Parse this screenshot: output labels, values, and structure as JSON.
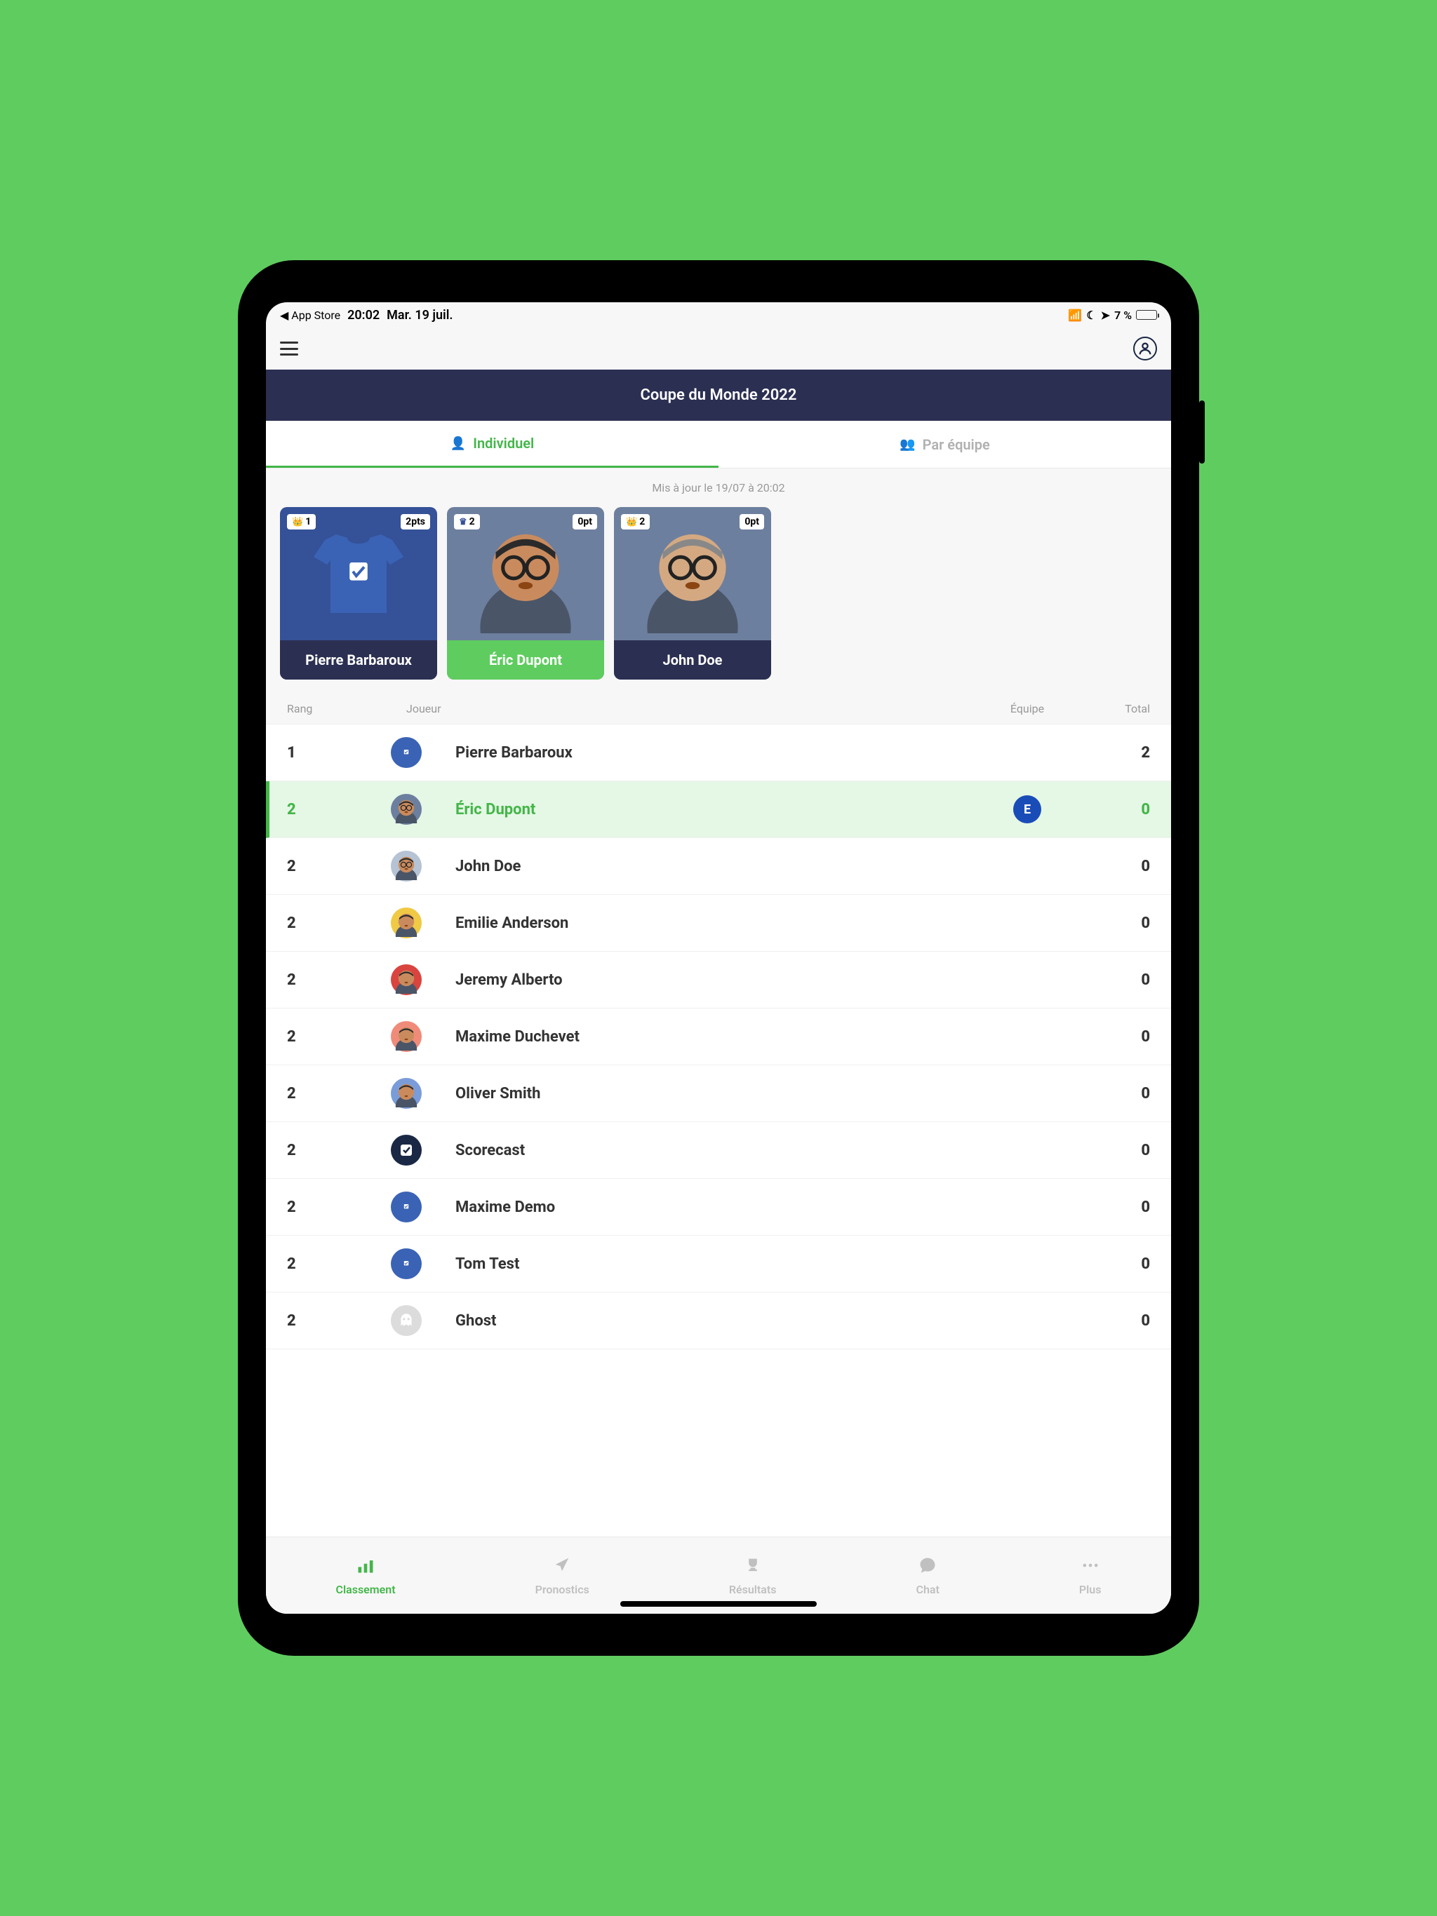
{
  "statusBar": {
    "backLabel": "◀ App Store",
    "time": "20:02",
    "date": "Mar. 19 juil.",
    "battery": "7 %"
  },
  "header": {
    "title": "Coupe du Monde 2022"
  },
  "tabs": {
    "individual": "Individuel",
    "team": "Par équipe"
  },
  "updated": "Mis à jour le 19/07 à 20:02",
  "podium": [
    {
      "rank": "1",
      "rankType": "crown",
      "pts": "2pts",
      "name": "Pierre Barbaroux",
      "nameBg": "dark",
      "avatarType": "jersey",
      "cardBg": "first"
    },
    {
      "rank": "2",
      "rankType": "crown-blue",
      "pts": "0pt",
      "name": "Éric Dupont",
      "nameBg": "green",
      "avatarType": "avatar1",
      "cardBg": "second"
    },
    {
      "rank": "2",
      "rankType": "crown",
      "pts": "0pt",
      "name": "John Doe",
      "nameBg": "dark",
      "avatarType": "avatar2",
      "cardBg": "third"
    }
  ],
  "tableHeaders": {
    "rank": "Rang",
    "player": "Joueur",
    "team": "Équipe",
    "total": "Total"
  },
  "rows": [
    {
      "rank": "1",
      "player": "Pierre Barbaroux",
      "total": "2",
      "avatarType": "jersey",
      "avatarColor": "#3a63b5",
      "highlighted": false,
      "team": ""
    },
    {
      "rank": "2",
      "player": "Éric Dupont",
      "total": "0",
      "avatarType": "face",
      "avatarColor": "#6d7f9e",
      "highlighted": true,
      "team": "E"
    },
    {
      "rank": "2",
      "player": "John Doe",
      "total": "0",
      "avatarType": "face",
      "avatarColor": "#b5c3d4",
      "highlighted": false,
      "team": ""
    },
    {
      "rank": "2",
      "player": "Emilie Anderson",
      "total": "0",
      "avatarType": "face",
      "avatarColor": "#f0c945",
      "highlighted": false,
      "team": ""
    },
    {
      "rank": "2",
      "player": "Jeremy Alberto",
      "total": "0",
      "avatarType": "face",
      "avatarColor": "#d9443f",
      "highlighted": false,
      "team": ""
    },
    {
      "rank": "2",
      "player": "Maxime Duchevet",
      "total": "0",
      "avatarType": "face",
      "avatarColor": "#f08b7a",
      "highlighted": false,
      "team": ""
    },
    {
      "rank": "2",
      "player": "Oliver Smith",
      "total": "0",
      "avatarType": "face",
      "avatarColor": "#7a9cd9",
      "highlighted": false,
      "team": ""
    },
    {
      "rank": "2",
      "player": "Scorecast",
      "total": "0",
      "avatarType": "logo",
      "avatarColor": "#1a2845",
      "highlighted": false,
      "team": ""
    },
    {
      "rank": "2",
      "player": "Maxime Demo",
      "total": "0",
      "avatarType": "jersey",
      "avatarColor": "#3a63b5",
      "highlighted": false,
      "team": ""
    },
    {
      "rank": "2",
      "player": "Tom Test",
      "total": "0",
      "avatarType": "jersey",
      "avatarColor": "#3a63b5",
      "highlighted": false,
      "team": ""
    },
    {
      "rank": "2",
      "player": "Ghost",
      "total": "0",
      "avatarType": "ghost",
      "avatarColor": "#dcdcdc",
      "highlighted": false,
      "team": ""
    }
  ],
  "bottomNav": {
    "classement": "Classement",
    "pronostics": "Pronostics",
    "resultats": "Résultats",
    "chat": "Chat",
    "plus": "Plus"
  }
}
